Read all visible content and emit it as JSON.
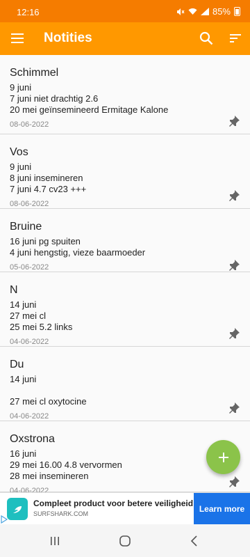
{
  "status_bar": {
    "time": "12:16",
    "battery": "85%"
  },
  "app_bar": {
    "title": "Notities"
  },
  "notes": [
    {
      "title": "Schimmel",
      "lines": [
        "9 juni",
        "7 juni niet drachtig 2.6",
        "20 mei geïnsemineerd Ermitage Kalone"
      ],
      "date": "08-06-2022"
    },
    {
      "title": "Vos",
      "lines": [
        "9 juni",
        "8 juni insemineren",
        "7 juni 4.7 cv23 +++"
      ],
      "date": "08-06-2022"
    },
    {
      "title": "Bruine",
      "lines": [
        "16 juni pg spuiten",
        "4 juni hengstig, vieze baarmoeder"
      ],
      "date": "05-06-2022"
    },
    {
      "title": "N",
      "lines": [
        "14 juni",
        "27 mei cl",
        "25 mei 5.2 links"
      ],
      "date": "04-06-2022"
    },
    {
      "title": "Du",
      "lines": [
        "14 juni",
        "",
        "27 mei cl oxytocine"
      ],
      "date": "04-06-2022"
    },
    {
      "title": "Oxstrona",
      "lines": [
        "16 juni",
        "29 mei 16.00 4.8 vervormen",
        "28 mei insemineren"
      ],
      "date": "04-06-2022"
    }
  ],
  "ad": {
    "headline": "Compleet product voor betere veiligheid",
    "domain": "SURFSHARK.COM",
    "cta": "Learn more"
  },
  "colors": {
    "status_bar": "#f57c00",
    "app_bar": "#ff9800",
    "fab": "#8bc34a",
    "ad_button": "#1a73e8"
  }
}
